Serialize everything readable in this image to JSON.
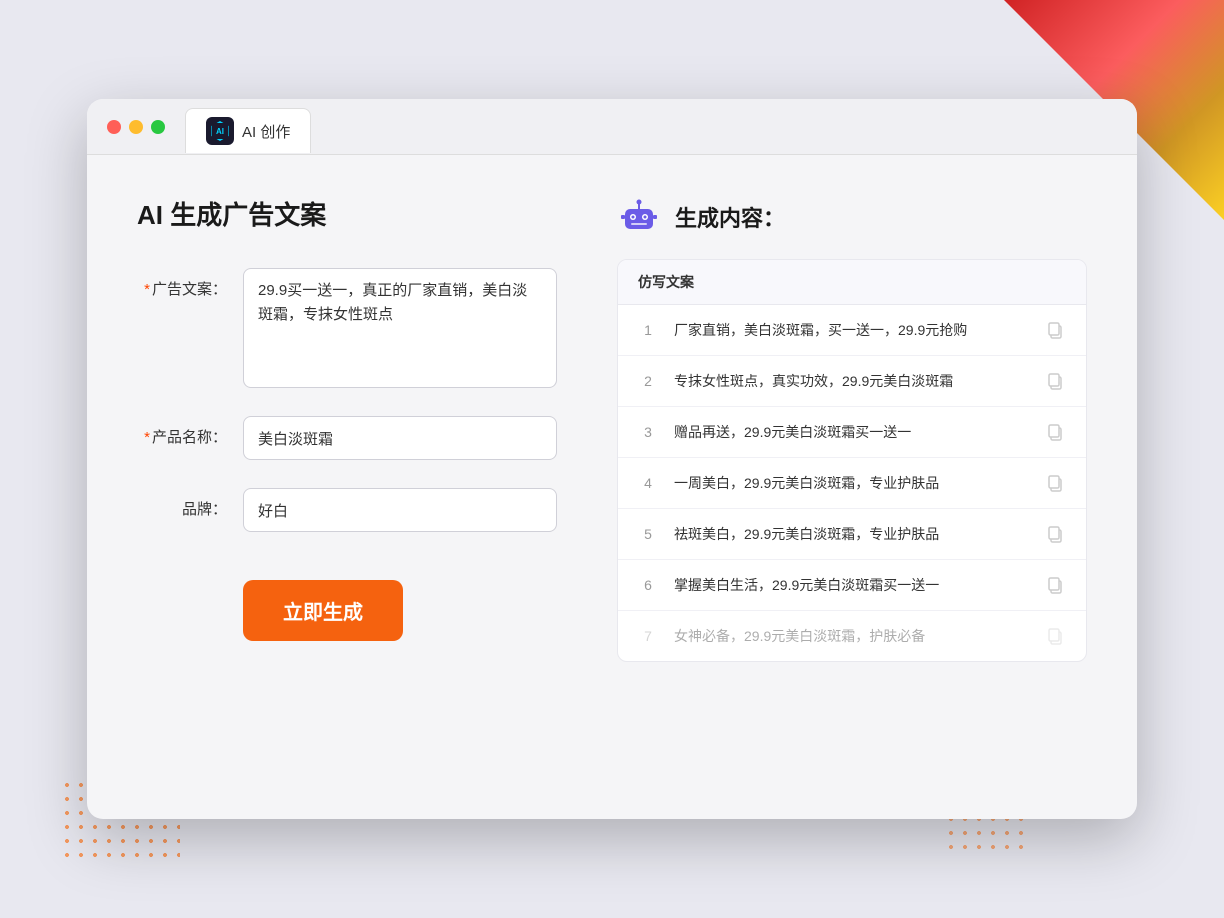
{
  "browser": {
    "tab_label": "AI 创作"
  },
  "page": {
    "title": "AI 生成广告文案",
    "right_title": "生成内容："
  },
  "form": {
    "ad_copy_label": "广告文案：",
    "ad_copy_required": "*",
    "ad_copy_value": "29.9买一送一，真正的厂家直销，美白淡斑霜，专抹女性斑点",
    "product_name_label": "产品名称：",
    "product_name_required": "*",
    "product_name_value": "美白淡斑霜",
    "brand_label": "品牌：",
    "brand_value": "好白",
    "generate_button": "立即生成"
  },
  "results": {
    "column_header": "仿写文案",
    "items": [
      {
        "num": "1",
        "text": "厂家直销，美白淡斑霜，买一送一，29.9元抢购",
        "faded": false
      },
      {
        "num": "2",
        "text": "专抹女性斑点，真实功效，29.9元美白淡斑霜",
        "faded": false
      },
      {
        "num": "3",
        "text": "赠品再送，29.9元美白淡斑霜买一送一",
        "faded": false
      },
      {
        "num": "4",
        "text": "一周美白，29.9元美白淡斑霜，专业护肤品",
        "faded": false
      },
      {
        "num": "5",
        "text": "祛斑美白，29.9元美白淡斑霜，专业护肤品",
        "faded": false
      },
      {
        "num": "6",
        "text": "掌握美白生活，29.9元美白淡斑霜买一送一",
        "faded": false
      },
      {
        "num": "7",
        "text": "女神必备，29.9元美白淡斑霜，护肤必备",
        "faded": true
      }
    ]
  }
}
